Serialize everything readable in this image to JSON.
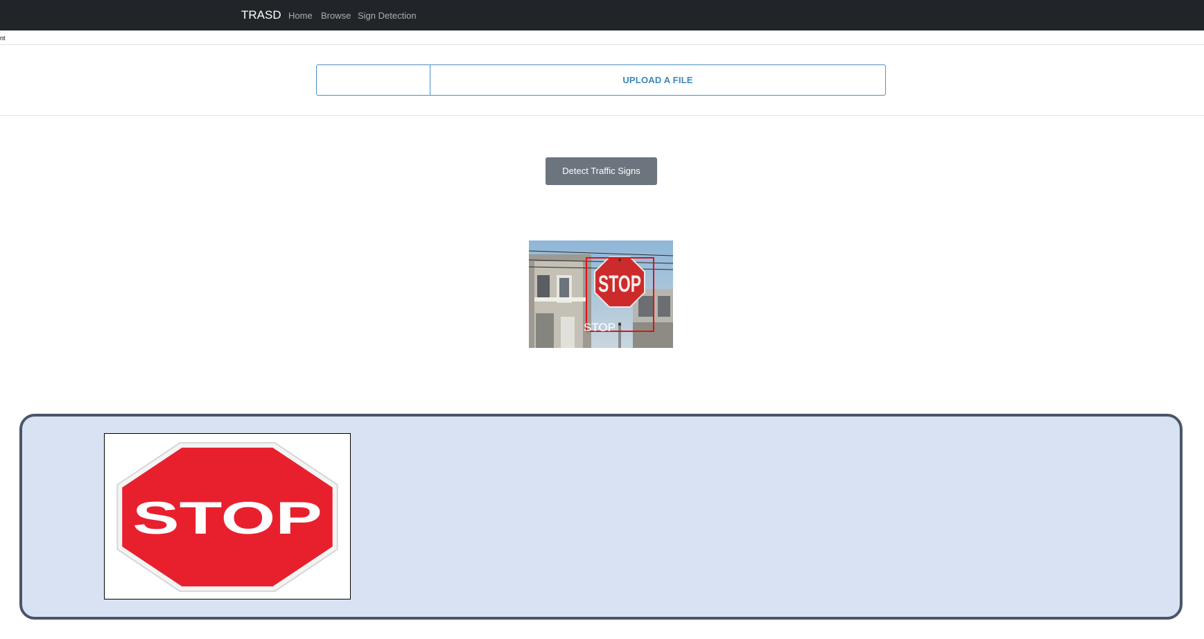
{
  "navbar": {
    "brand": "TRASD",
    "links": [
      "Home",
      "Browse",
      "Sign Detection"
    ]
  },
  "page": {
    "clipped_text": "nt"
  },
  "upload": {
    "label": "UPLOAD A FILE"
  },
  "detect": {
    "button_label": "Detect Traffic Signs"
  },
  "result": {
    "sign_text": "STOP",
    "detection_label": "STOP"
  },
  "reference_sign": {
    "text": "STOP"
  },
  "colors": {
    "navbar_bg": "#212529",
    "accent": "#3a86bd",
    "button_bg": "#6c757d",
    "panel_bg": "#d9e2f2",
    "panel_border": "#4a5568",
    "stop_red": "#e8202e",
    "box_red": "#e0101a"
  }
}
